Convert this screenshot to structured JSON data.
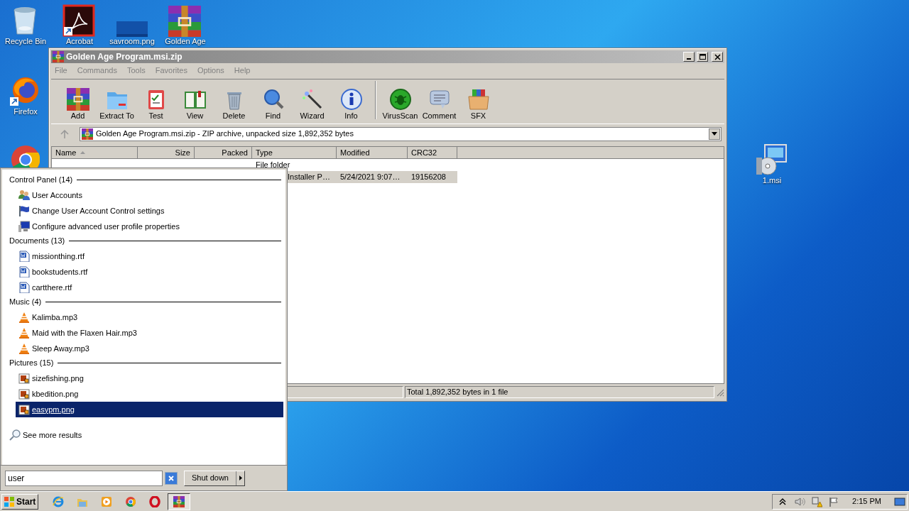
{
  "desktop_icons": [
    {
      "kind": "recycle",
      "label": "Recycle Bin"
    },
    {
      "kind": "acrobat",
      "label": "Acrobat"
    },
    {
      "kind": "image",
      "label": "savroom.png"
    },
    {
      "kind": "winrar",
      "label": "Golden Age"
    },
    {
      "kind": "firefox",
      "label": "Firefox"
    },
    {
      "kind": "chrome"
    },
    {
      "kind": "msi",
      "label": "1.msi"
    }
  ],
  "window": {
    "title": "Golden Age Program.msi.zip",
    "menu": [
      "File",
      "Commands",
      "Tools",
      "Favorites",
      "Options",
      "Help"
    ],
    "toolbar": [
      {
        "kind": "add",
        "label": "Add"
      },
      {
        "kind": "extract",
        "label": "Extract To"
      },
      {
        "kind": "test",
        "label": "Test"
      },
      {
        "kind": "view",
        "label": "View"
      },
      {
        "kind": "delete",
        "label": "Delete"
      },
      {
        "kind": "find",
        "label": "Find"
      },
      {
        "kind": "wizard",
        "label": "Wizard"
      },
      {
        "kind": "info",
        "label": "Info"
      },
      {
        "kind": "separator"
      },
      {
        "kind": "virus",
        "label": "VirusScan"
      },
      {
        "kind": "comment",
        "label": "Comment"
      },
      {
        "kind": "sfx",
        "label": "SFX"
      }
    ],
    "address": "Golden Age Program.msi.zip - ZIP archive, unpacked size 1,892,352 bytes",
    "columns": [
      {
        "label": "Name",
        "sorted": true
      },
      {
        "label": "Size",
        "sorted": false
      },
      {
        "label": "Packed",
        "sorted": false
      },
      {
        "label": "Type",
        "sorted": false
      },
      {
        "label": "Modified",
        "sorted": false
      },
      {
        "label": "CRC32",
        "sorted": false
      }
    ],
    "rows": [
      {
        "selected": false,
        "type": "File folder"
      },
      {
        "selected": true,
        "type": "Installer P…",
        "modified": "5/24/2021 9:07…",
        "crc32": "19156208"
      }
    ],
    "status": "Total 1,892,352 bytes in 1 file"
  },
  "start_menu": {
    "groups": [
      {
        "title": "Control Panel (14)",
        "items": [
          {
            "kind": "users",
            "label": "User Accounts",
            "selected": false
          },
          {
            "kind": "flag",
            "label": "Change User Account Control settings",
            "selected": false
          },
          {
            "kind": "monitor",
            "label": "Configure advanced user profile properties",
            "selected": false
          }
        ]
      },
      {
        "title": "Documents (13)",
        "items": [
          {
            "kind": "doc",
            "label": "missionthing.rtf",
            "selected": false
          },
          {
            "kind": "doc",
            "label": "bookstudents.rtf",
            "selected": false
          },
          {
            "kind": "doc",
            "label": "cartthere.rtf",
            "selected": false
          }
        ]
      },
      {
        "title": "Music (4)",
        "items": [
          {
            "kind": "cone",
            "label": "Kalimba.mp3",
            "selected": false
          },
          {
            "kind": "cone",
            "label": "Maid with the Flaxen Hair.mp3",
            "selected": false
          },
          {
            "kind": "cone",
            "label": "Sleep Away.mp3",
            "selected": false
          }
        ]
      },
      {
        "title": "Pictures (15)",
        "items": [
          {
            "kind": "pic",
            "label": "sizefishing.png",
            "selected": false
          },
          {
            "kind": "pic",
            "label": "kbedition.png",
            "selected": false
          },
          {
            "kind": "pic",
            "label": "easypm.png",
            "selected": true
          }
        ]
      }
    ],
    "more": "See more results",
    "search": "user",
    "shutdown": "Shut down"
  },
  "taskbar": {
    "start": "Start",
    "apps": [
      {
        "kind": "ie",
        "active": false
      },
      {
        "kind": "explorer",
        "active": false
      },
      {
        "kind": "media",
        "active": false
      },
      {
        "kind": "chrome",
        "active": false
      },
      {
        "kind": "opera",
        "active": false
      },
      {
        "kind": "winrar",
        "active": true
      }
    ],
    "clock": "2:15 PM"
  }
}
